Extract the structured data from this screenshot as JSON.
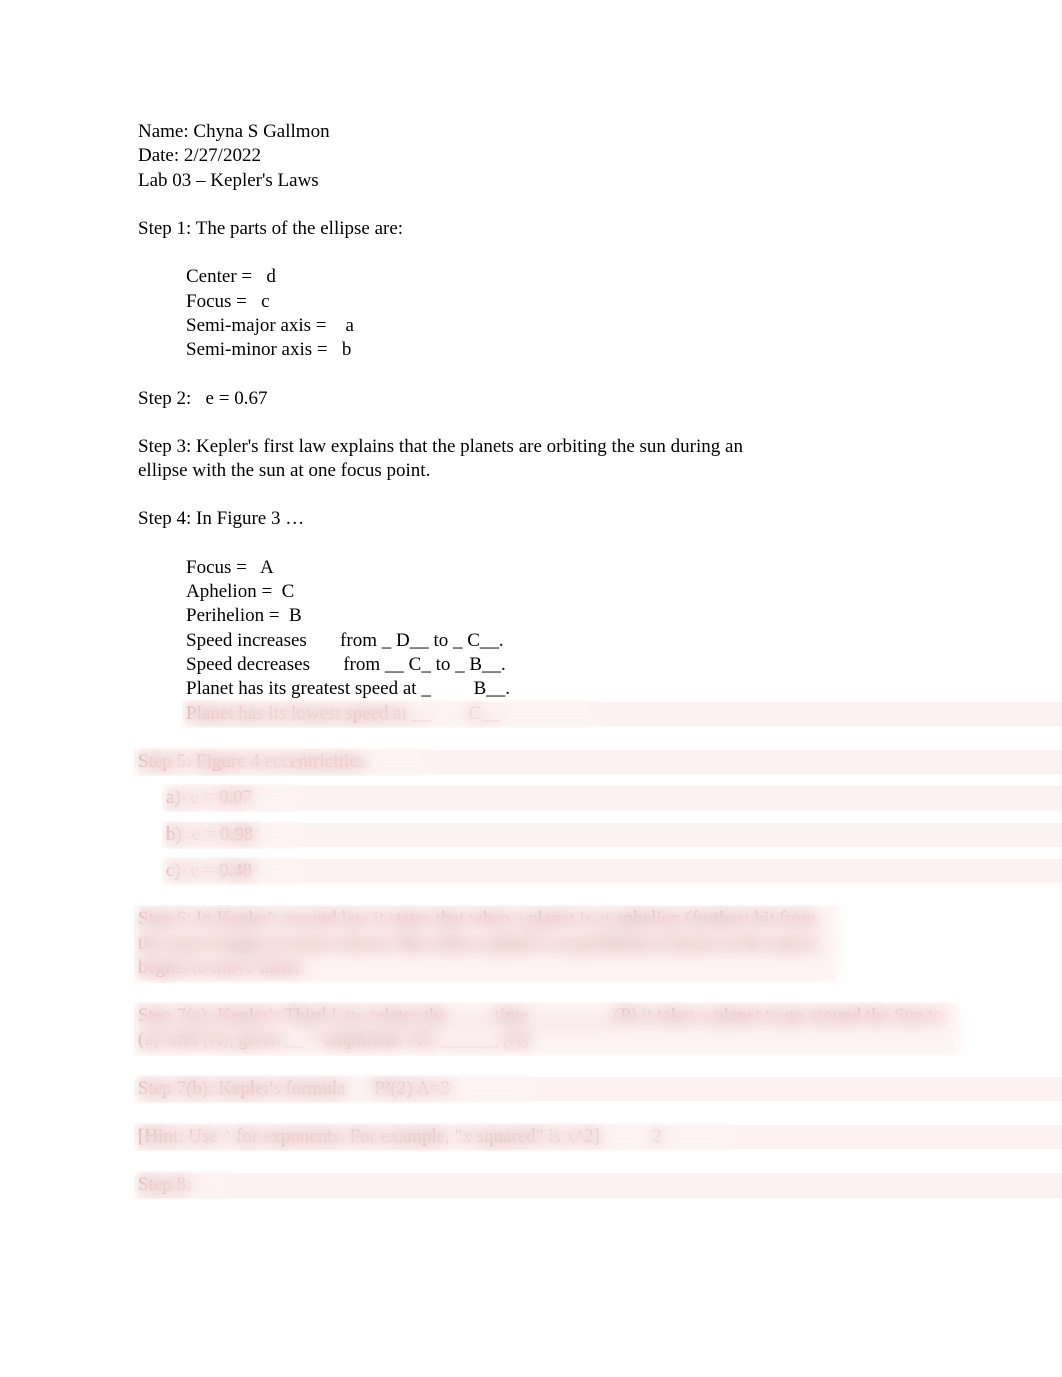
{
  "header": {
    "name_label": "Name: ",
    "name_value": "Chyna S Gallmon",
    "date_label": "Date: ",
    "date_value": "2/27/2022",
    "lab_line": "Lab 03 – Kepler's Laws"
  },
  "step1": {
    "title": "Step 1: The parts of the ellipse are:",
    "center": "Center =   d",
    "focus": "Focus =   c",
    "semi_major": "Semi-major axis =    a",
    "semi_minor": "Semi-minor axis =   b"
  },
  "step2": {
    "line": "Step 2:   e = 0.67"
  },
  "step3": {
    "line": "Step 3:   Kepler's first law explains that the planets are orbiting the sun during an ellipse with the sun at one focus point."
  },
  "step4": {
    "title": "Step 4: In Figure 3 …",
    "focus": "Focus =   A",
    "aphelion": "Aphelion =  C",
    "perihelion": "Perihelion =  B",
    "speed_inc": "Speed increases       from _ D__ to _ C__.",
    "speed_dec": "Speed decreases       from __ C_ to _ B__.",
    "greatest": "Planet has its greatest speed at _         B__.",
    "lowest": "Planet has its lowest speed at __        C__"
  },
  "step5": {
    "title": "Step 5: Figure 4 eccentricities",
    "a": "a)  e = 0.07",
    "b": "b)  e = 0.98",
    "c": "c)  e = 0.48"
  },
  "step6": {
    "line": "Step 6:     In Kepler's second law it states that when a planet is at aphelion (furthest bit from the sun) it begins to move slower. But when a planet is at perihelion (closest to the sun) it begins to move faster."
  },
  "step7a": {
    "line": "Step 7(a): Kepler's Third Law relates the  ____         time ________  (P) it takes a planet to go around the Sun to (a) with (A), given __ ʹ² amplitude/ AU  ______  (A)"
  },
  "step7b": {
    "line": "Step 7(b): Kepler's formula      P²(2) A=3"
  },
  "hint": {
    "line": "[Hint: Use ^ for exponents. For example, \"x squared\" is x^2]           2"
  },
  "step8": {
    "line": "Step 8:"
  }
}
